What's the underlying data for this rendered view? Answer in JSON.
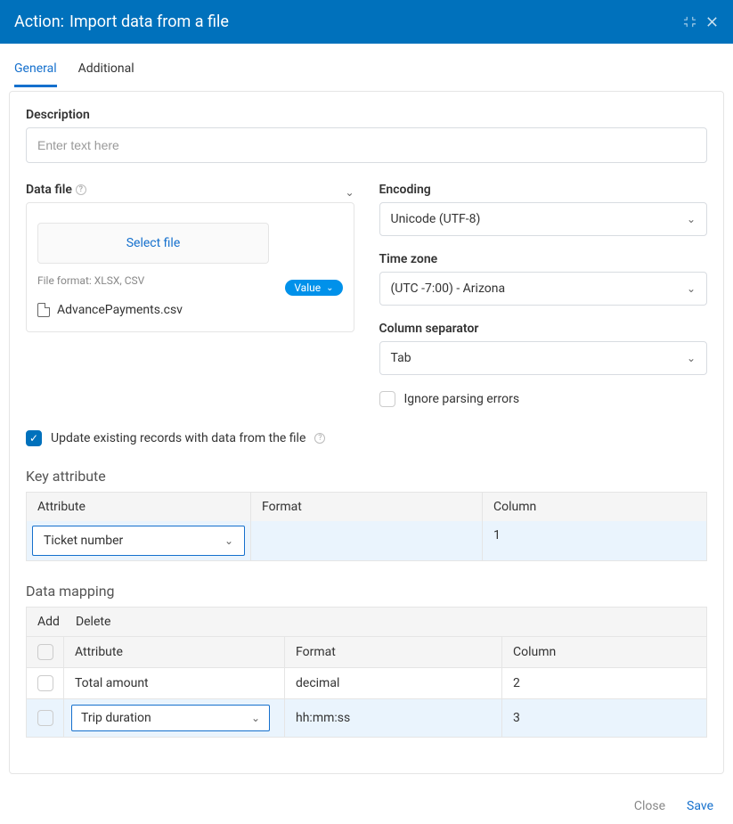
{
  "header": {
    "prefix": "Action:",
    "title": "Import data from a file"
  },
  "tabs": {
    "general": "General",
    "additional": "Additional"
  },
  "description": {
    "label": "Description",
    "placeholder": "Enter text here",
    "value": ""
  },
  "datafile": {
    "label": "Data file",
    "select_button": "Select file",
    "format_hint": "File format: XLSX, CSV",
    "value_pill": "Value",
    "filename": "AdvancePayments.csv"
  },
  "encoding": {
    "label": "Encoding",
    "value": "Unicode (UTF-8)"
  },
  "timezone": {
    "label": "Time zone",
    "value": "(UTC -7:00) - Arizona"
  },
  "separator": {
    "label": "Column separator",
    "value": "Tab"
  },
  "ignore_errors": {
    "label": "Ignore parsing errors",
    "checked": false
  },
  "update_existing": {
    "label": "Update existing records with data from the file",
    "checked": true
  },
  "key_attribute": {
    "title": "Key attribute",
    "headers": {
      "attribute": "Attribute",
      "format": "Format",
      "column": "Column"
    },
    "row": {
      "attribute": "Ticket number",
      "format": "",
      "column": "1"
    }
  },
  "data_mapping": {
    "title": "Data mapping",
    "toolbar": {
      "add": "Add",
      "delete": "Delete"
    },
    "headers": {
      "attribute": "Attribute",
      "format": "Format",
      "column": "Column"
    },
    "rows": [
      {
        "attribute": "Total amount",
        "format": "decimal",
        "column": "2",
        "selected": false
      },
      {
        "attribute": "Trip duration",
        "format": "hh:mm:ss",
        "column": "3",
        "selected": true
      }
    ]
  },
  "footer": {
    "close": "Close",
    "save": "Save"
  }
}
